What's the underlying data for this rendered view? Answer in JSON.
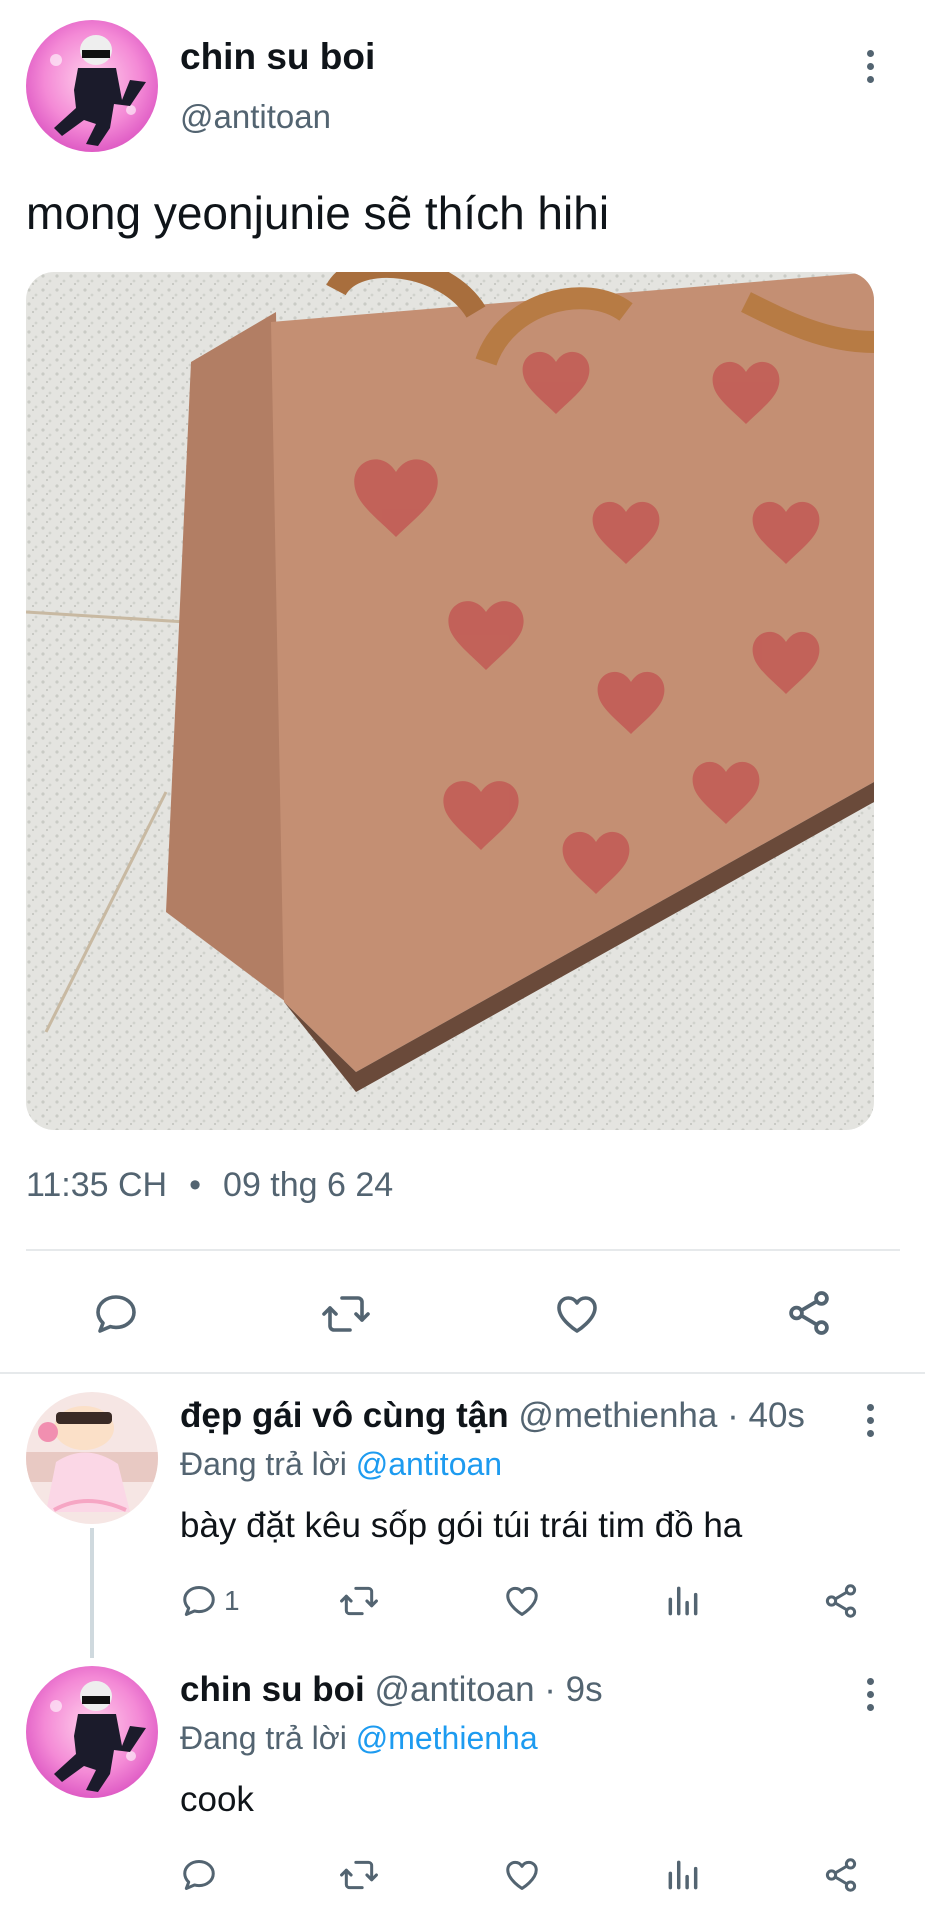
{
  "tweet": {
    "display_name": "chin su boi",
    "handle": "@antitoan",
    "text": "mong yeonjunie sẽ thích hihi",
    "time": "11:35 CH",
    "separator": "•",
    "date": "09 thg 6 24"
  },
  "replies": [
    {
      "display_name": "đẹp gái vô cùng tận",
      "handle": "@methienha",
      "age": "· 40s",
      "replying_prefix": "Đang trả lời",
      "replying_to": "@antitoan",
      "text": "bày đặt kêu sốp gói túi trái tim đồ ha",
      "reply_count": "1"
    },
    {
      "display_name": "chin su boi",
      "handle": "@antitoan",
      "age": "· 9s",
      "replying_prefix": "Đang trả lời",
      "replying_to": "@methienha",
      "text": "cook",
      "reply_count": ""
    }
  ],
  "icons": {
    "reply": "reply-icon",
    "retweet": "retweet-icon",
    "like": "like-icon",
    "share": "share-icon",
    "views": "views-icon",
    "more": "more-icon"
  },
  "colors": {
    "text": "#0f1419",
    "muted": "#536471",
    "link": "#1d9bf0",
    "divider": "#e6e9eb"
  }
}
